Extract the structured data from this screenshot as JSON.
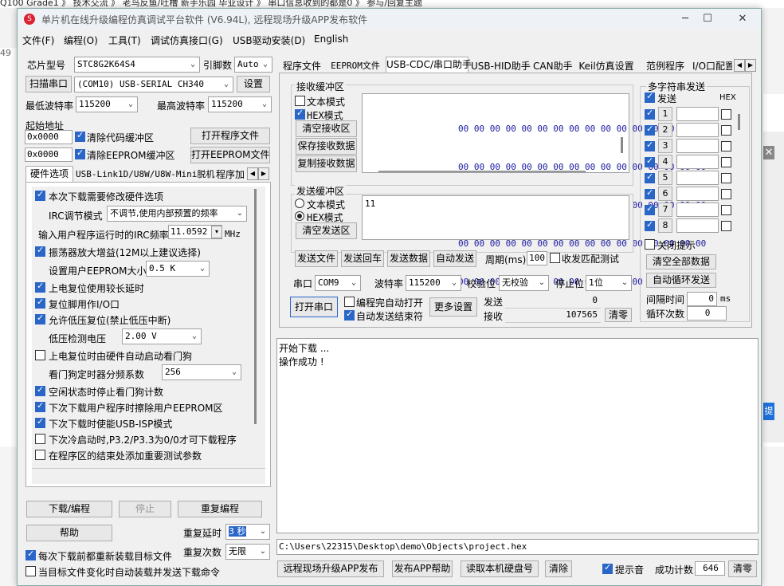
{
  "background": {
    "strip_text": "Q100 Grade1 》 技术交流 》 老鸟反鱼/吐槽 新手乐园 毕业设计 》 串口信息收到的都是0 》 参与/回复主题",
    "left_number": "49",
    "blue_label": "提"
  },
  "window": {
    "title": "单片机在线升级编程仿真调试平台软件 (V6.94L), 远程现场升级APP发布软件",
    "minimize": "─",
    "maximize": "☐",
    "close": "✕"
  },
  "menu": [
    "文件(F)",
    "编程(O)",
    "工具(T)",
    "调试仿真接口(G)",
    "USB驱动安装(D)",
    "English"
  ],
  "left": {
    "chip_label": "芯片型号",
    "chip_value": "STC8G2K64S4",
    "pin_label": "引脚数",
    "pin_value": "Auto",
    "scan_port_btn": "扫描串口",
    "port_value": "(COM10) USB-SERIAL CH340",
    "settings_btn": "设置",
    "min_baud_label": "最低波特率",
    "min_baud_value": "115200",
    "max_baud_label": "最高波特率",
    "max_baud_value": "115200",
    "start_addr_label": "起始地址",
    "addr1": "0x0000",
    "clear_code_label": "清除代码缓冲区",
    "open_prog_btn": "打开程序文件",
    "addr2": "0x0000",
    "clear_eeprom_label": "清除EEPROM缓冲区",
    "open_eeprom_btn": "打开EEPROM文件",
    "tabs": [
      "硬件选项",
      "USB-Link1D/U8W/U8W-Mini脱机",
      "程序加"
    ],
    "options": {
      "opt1": "本次下载需要修改硬件选项",
      "irc_label": "IRC调节模式",
      "irc_value": "不调节,使用内部预置的频率",
      "freq_label": "输入用户程序运行时的IRC频率",
      "freq_value": "11.0592",
      "freq_unit": "MHz",
      "opt2": "振荡器放大增益(12M以上建议选择)",
      "eeprom_size_label": "设置用户EEPROM大小",
      "eeprom_size_value": "0.5 K",
      "opt3": "上电复位使用较长延时",
      "opt4": "复位脚用作I/O口",
      "opt5": "允许低压复位(禁止低压中断)",
      "lvd_label": "低压检测电压",
      "lvd_value": "2.00 V",
      "opt6": "上电复位时由硬件自动启动看门狗",
      "wdt_label": "看门狗定时器分频系数",
      "wdt_value": "256",
      "opt7": "空闲状态时停止看门狗计数",
      "opt8": "下次下载用户程序时擦除用户EEPROM区",
      "opt9": "下次下载时使能USB-ISP模式",
      "opt10": "下次冷启动时,P3.2/P3.3为0/0才可下载程序",
      "opt11": "在程序区的结束处添加重要测试参数"
    },
    "download_btn": "下载/编程",
    "stop_btn": "停止",
    "reprogram_btn": "重复编程",
    "help_btn": "帮助",
    "repeat_delay_label": "重复延时",
    "repeat_delay_value": "3 秒",
    "repeat_count_label": "重复次数",
    "repeat_count_value": "无限",
    "reload_label": "每次下载前都重新装载目标文件",
    "autosend_label": "当目标文件变化时自动装载并发送下载命令"
  },
  "right": {
    "tabs": [
      "程序文件",
      "EEPROM文件",
      "USB-CDC/串口助手",
      "USB-HID助手",
      "CAN助手",
      "Keil仿真设置",
      "范例程序",
      "I/O口配置"
    ],
    "recv_group": "接收缓冲区",
    "recv_text_mode": "文本模式",
    "recv_hex_mode": "HEX模式",
    "clear_recv_btn": "清空接收区",
    "save_recv_btn": "保存接收数据",
    "copy_recv_btn": "复制接收数据",
    "hex_lines": [
      "00 00 00 00 00 00 00 00 00 00 00 00 00 00 00 00",
      "00 00 00 00 00 00 00 00 00 00 00 00 00 00 00 00",
      "00 00 00 00 00 00 00 00 00 00 00 00 00 00 00 00",
      "00 00 00 00 00 00 00 00 00 00 00 00 00 00 00 00",
      "00 00 00 00 00 00 00 00 00 00 00 00 00 00 00 00"
    ],
    "send_group": "发送缓冲区",
    "send_text_mode": "文本模式",
    "send_hex_mode": "HEX模式",
    "clear_send_btn": "清空发送区",
    "send_value": "11",
    "send_file_btn": "发送文件",
    "send_return_btn": "发送回车",
    "send_data_btn": "发送数据",
    "auto_send_btn": "自动发送",
    "period_label": "周期(ms)",
    "period_value": "100",
    "match_label": "收发匹配测试",
    "port_label": "串口",
    "port_value": "COM9",
    "baud_label": "波特率",
    "baud_value": "115200",
    "parity_label": "校验位",
    "parity_value": "无校验",
    "stop_label": "停止位",
    "stop_value": "1位",
    "open_port_btn": "打开串口",
    "auto_open_label": "编程完自动打开",
    "auto_send_end_label": "自动发送结束符",
    "more_btn": "更多设置",
    "send_count_label": "发送",
    "send_count": "0",
    "recv_count_label": "接收",
    "recv_count": "107565",
    "clear_count_btn": "清零",
    "multi_group": "多字符串发送",
    "multi_send_label": "发送",
    "multi_hex_label": "HEX",
    "multi_rows": [
      "1",
      "2",
      "3",
      "4",
      "5",
      "6",
      "7",
      "8"
    ],
    "close_tip_label": "关闭提示",
    "clear_all_btn": "清空全部数据",
    "auto_loop_btn": "自动循环发送",
    "interval_label": "间隔时间",
    "interval_value": "0",
    "interval_unit": "ms",
    "loop_count_label": "循环次数",
    "loop_count_value": "0",
    "log_lines": [
      "开始下载 ...",
      "操作成功 !"
    ],
    "path": "C:\\Users\\22315\\Desktop\\demo\\Objects\\project.hex",
    "remote_btn": "远程现场升级APP发布",
    "app_help_btn": "发布APP帮助",
    "read_disk_btn": "读取本机硬盘号",
    "clear_btn": "清除",
    "sound_label": "提示音",
    "success_label": "成功计数",
    "success_value": "646",
    "success_clear_btn": "清零"
  }
}
